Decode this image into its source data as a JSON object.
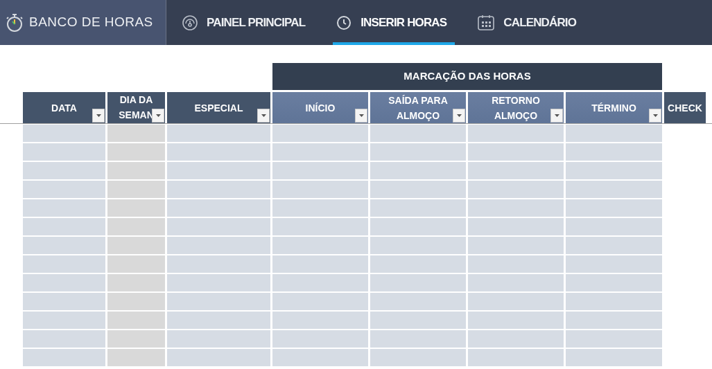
{
  "brand": {
    "title": "BANCO DE HORAS"
  },
  "tabs": [
    {
      "label": "PAINEL PRINCIPAL",
      "selected": false
    },
    {
      "label": "INSERIR HORAS",
      "selected": true
    },
    {
      "label": "CALENDÁRIO",
      "selected": false
    }
  ],
  "table": {
    "group_header": "MARCAÇÃO DAS HORAS",
    "columns": [
      {
        "label": "DATA",
        "kind": "plain",
        "filter": true
      },
      {
        "label": "DIA DA SEMAN",
        "kind": "weekday",
        "filter": true
      },
      {
        "label": "ESPECIAL",
        "kind": "plain",
        "filter": true
      },
      {
        "label": "INÍCIO",
        "kind": "time",
        "filter": true
      },
      {
        "label": "SAÍDA PARA ALMOÇO",
        "kind": "time",
        "filter": true
      },
      {
        "label": "RETORNO ALMOÇO",
        "kind": "time",
        "filter": true
      },
      {
        "label": "TÉRMINO",
        "kind": "time",
        "filter": true
      },
      {
        "label": "CHECK",
        "kind": "check",
        "filter": false
      }
    ]
  }
}
